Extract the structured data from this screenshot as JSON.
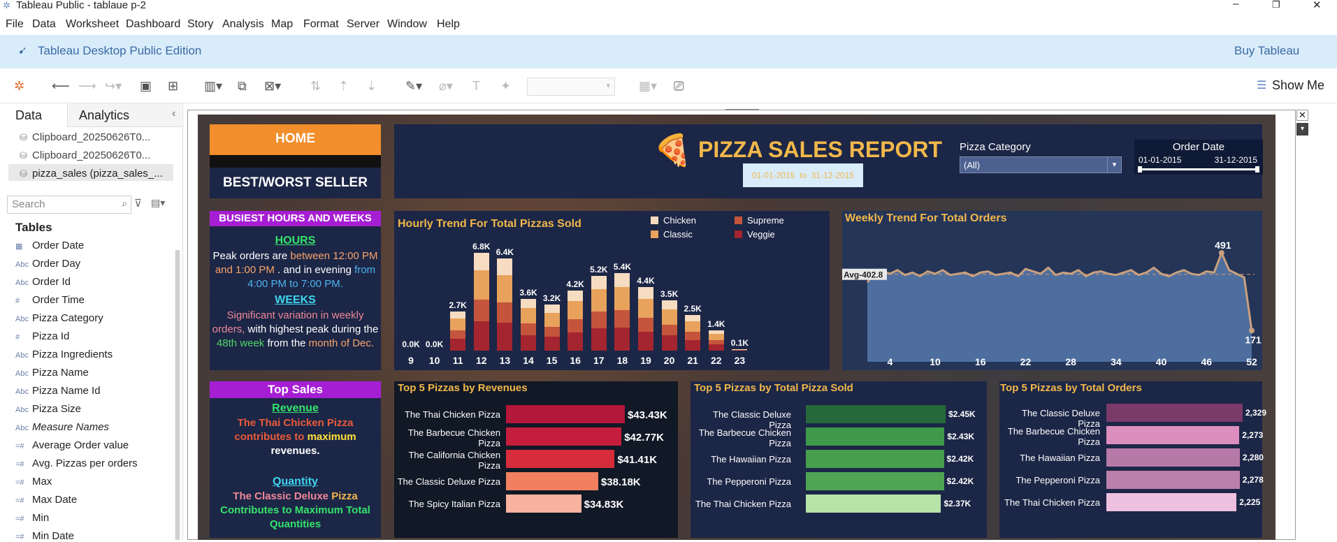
{
  "window": {
    "title": "Tableau Public - tablaue p-2",
    "controls": [
      "–",
      "❐",
      "✕"
    ]
  },
  "menu": [
    "File",
    "Data",
    "Worksheet",
    "Dashboard",
    "Story",
    "Analysis",
    "Map",
    "Format",
    "Server",
    "Window",
    "Help"
  ],
  "banner": {
    "edition": "Tableau Desktop Public Edition",
    "buy": "Buy Tableau"
  },
  "toolbar": {
    "show_me": "Show Me"
  },
  "side": {
    "tab_data": "Data",
    "tab_analytics": "Analytics",
    "sources": [
      "Clipboard_20250626T0...",
      "Clipboard_20250626T0...",
      "pizza_sales (pizza_sales_..."
    ],
    "search_placeholder": "Search",
    "tables_label": "Tables",
    "fields": [
      {
        "icon": "calendar",
        "type": "▦",
        "name": "Order Date"
      },
      {
        "icon": "abc",
        "type": "Abc",
        "name": "Order Day"
      },
      {
        "icon": "abc",
        "type": "Abc",
        "name": "Order Id"
      },
      {
        "icon": "calendar",
        "type": "#",
        "name": "Order Time"
      },
      {
        "icon": "abc",
        "type": "Abc",
        "name": "Pizza Category"
      },
      {
        "icon": "number",
        "type": "#",
        "name": "Pizza Id"
      },
      {
        "icon": "abc",
        "type": "Abc",
        "name": "Pizza Ingredients"
      },
      {
        "icon": "abc",
        "type": "Abc",
        "name": "Pizza Name"
      },
      {
        "icon": "abc",
        "type": "Abc",
        "name": "Pizza Name Id"
      },
      {
        "icon": "abc",
        "type": "Abc",
        "name": "Pizza Size"
      },
      {
        "icon": "abc",
        "type": "Abc",
        "name": "Measure Names"
      },
      {
        "icon": "calc",
        "type": "=#",
        "name": "Average Order value"
      },
      {
        "icon": "calc",
        "type": "=#",
        "name": "Avg. Pizzas per orders"
      },
      {
        "icon": "calc",
        "type": "=#",
        "name": "Max"
      },
      {
        "icon": "calc",
        "type": "=#",
        "name": "Max Date"
      },
      {
        "icon": "calc",
        "type": "=#",
        "name": "Min"
      },
      {
        "icon": "calc",
        "type": "=#",
        "name": "Min Date"
      }
    ]
  },
  "dashboard": {
    "home": "HOME",
    "bestworst": "BEST/WORST SELLER",
    "report_title": "PIZZA SALES REPORT",
    "date_range": "01-01-2015  to  31-12-2015",
    "filter_category": {
      "label": "Pizza Category",
      "value": "(All)"
    },
    "filter_date": {
      "label": "Order Date",
      "from": "01-01-2015",
      "to": "31-12-2015"
    },
    "busiest": {
      "title": "BUSIEST HOURS AND WEEKS",
      "hours_head": "HOURS",
      "hours_1": "Peak orders are ",
      "hours_2": "between 12:00 PM and 1:00 PM",
      "hours_3": " . and in evening ",
      "hours_4": "from 4:00 PM to 7:00 PM.",
      "weeks_head": "WEEKS",
      "weeks_1": "Significant variation in weekly orders,",
      "weeks_2": " with highest peak during the ",
      "weeks_3": "48th week",
      "weeks_4": " from the ",
      "weeks_5": "month of Dec."
    },
    "topsales": {
      "title": "Top Sales",
      "rev_head": "Revenue",
      "rev_1": "The Thai Chicken Pizza contributes to ",
      "rev_2": "maximum",
      "rev_3": " revenues.",
      "qty_head": "Quantity",
      "qty_1": "The Classic Deluxe ",
      "qty_2": "Pizza",
      "qty_3": " Contributes to Maximum Total Quantities"
    }
  },
  "chart_data": [
    {
      "type": "bar",
      "title": "Hourly Trend For Total Pizzas Sold",
      "legend": [
        "Chicken",
        "Supreme",
        "Classic",
        "Veggie"
      ],
      "colors": {
        "Chicken": "#f6dcc0",
        "Classic": "#e8a25c",
        "Supreme": "#c4553c",
        "Veggie": "#a42530"
      },
      "categories": [
        "9",
        "10",
        "11",
        "12",
        "13",
        "14",
        "15",
        "16",
        "17",
        "18",
        "19",
        "20",
        "21",
        "22",
        "23"
      ],
      "labels": [
        "0.0K",
        "0.0K",
        "2.7K",
        "6.8K",
        "6.4K",
        "3.6K",
        "3.2K",
        "4.2K",
        "5.2K",
        "5.4K",
        "4.4K",
        "3.5K",
        "2.5K",
        "1.4K",
        "0.1K"
      ],
      "values": [
        0.0,
        0.0,
        2.7,
        6.8,
        6.4,
        3.6,
        3.2,
        4.2,
        5.2,
        5.4,
        4.4,
        3.5,
        2.5,
        1.4,
        0.1
      ]
    },
    {
      "type": "area",
      "title": "Weekly Trend For Total Orders",
      "avg_label": "Avg-402.8",
      "avg": 402.8,
      "max_label": "491",
      "min_label": "171",
      "xticks": [
        "4",
        "10",
        "16",
        "22",
        "28",
        "34",
        "40",
        "46",
        "52"
      ],
      "values": [
        370,
        410,
        415,
        405,
        420,
        400,
        410,
        395,
        415,
        405,
        420,
        400,
        405,
        410,
        395,
        410,
        415,
        400,
        405,
        410,
        395,
        425,
        415,
        405,
        430,
        400,
        410,
        405,
        420,
        395,
        410,
        415,
        405,
        400,
        410,
        420,
        400,
        410,
        430,
        405,
        395,
        410,
        420,
        405,
        400,
        415,
        410,
        491,
        420,
        405,
        390,
        171
      ]
    },
    {
      "type": "bar",
      "title": "Top 5 Pizzas by Revenues",
      "categories": [
        "The Thai Chicken Pizza",
        "The Barbecue Chicken Pizza",
        "The California Chicken Pizza",
        "The Classic Deluxe Pizza",
        "The Spicy Italian Pizza"
      ],
      "labels": [
        "$43.43K",
        "$42.77K",
        "$41.41K",
        "$38.18K",
        "$34.83K"
      ],
      "values": [
        43.43,
        42.77,
        41.41,
        38.18,
        34.83
      ],
      "colors": [
        "#b3173a",
        "#c41e3c",
        "#d72c3c",
        "#f08060",
        "#f8b2a0"
      ]
    },
    {
      "type": "bar",
      "title": "Top 5 Pizzas by Total Pizza Sold",
      "categories": [
        "The Classic Deluxe Pizza",
        "The Barbecue Chicken Pizza",
        "The Hawaiian Pizza",
        "The Pepperoni Pizza",
        "The Thai Chicken Pizza"
      ],
      "labels": [
        "$2.45K",
        "$2.43K",
        "$2.42K",
        "$2.42K",
        "$2.37K"
      ],
      "values": [
        2.45,
        2.43,
        2.42,
        2.42,
        2.37
      ],
      "colors": [
        "#27693a",
        "#3e9a4a",
        "#479f4d",
        "#4fa454",
        "#b6e3a8"
      ]
    },
    {
      "type": "bar",
      "title": "Top 5 Pizzas by Total Orders",
      "categories": [
        "The Classic Deluxe Pizza",
        "The Barbecue Chicken Pizza",
        "The Hawaiian Pizza",
        "The Pepperoni Pizza",
        "The Thai Chicken Pizza"
      ],
      "labels": [
        "2,329",
        "2,273",
        "2,280",
        "2,278",
        "2,225"
      ],
      "values": [
        2329,
        2273,
        2280,
        2278,
        2225
      ],
      "colors": [
        "#7a3a6a",
        "#dc8fbf",
        "#b77aa8",
        "#bc80ad",
        "#eec0e0"
      ]
    }
  ]
}
